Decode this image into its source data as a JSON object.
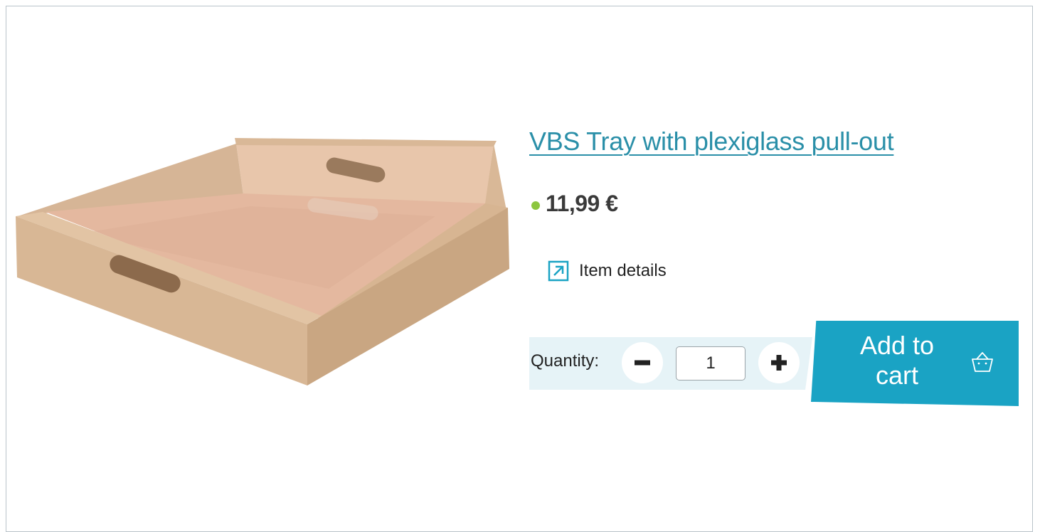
{
  "product": {
    "title": "VBS Tray with plexiglass pull-out",
    "price": "11,99 €",
    "details_label": "Item details",
    "image_icon": "tray-product-image"
  },
  "quantity": {
    "label": "Quantity:",
    "value": "1"
  },
  "cart": {
    "label_line1": "Add to",
    "label_line2": "cart",
    "icon": "basket-icon"
  },
  "colors": {
    "accent": "#1aa3c4",
    "title": "#2a8fa8",
    "stock_dot": "#8cc63f",
    "quantity_band": "#e6f3f7"
  }
}
